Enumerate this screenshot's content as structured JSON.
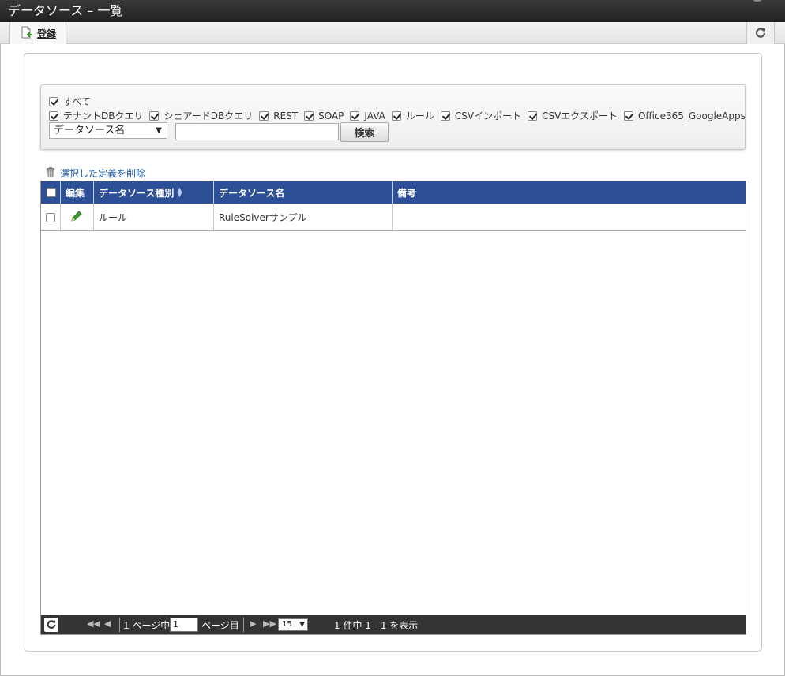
{
  "window": {
    "title": "データソース – 一覧"
  },
  "toolbar": {
    "register_label": "登録"
  },
  "filters": {
    "all_label": "すべて",
    "types": [
      {
        "label": "テナントDBクエリ",
        "checked": true
      },
      {
        "label": "シェアードDBクエリ",
        "checked": true
      },
      {
        "label": "REST",
        "checked": true
      },
      {
        "label": "SOAP",
        "checked": true
      },
      {
        "label": "JAVA",
        "checked": true
      },
      {
        "label": "ルール",
        "checked": true
      },
      {
        "label": "CSVインポート",
        "checked": true
      },
      {
        "label": "CSVエクスポート",
        "checked": true
      },
      {
        "label": "Office365_GoogleApps",
        "checked": true
      }
    ],
    "field_select": "データソース名",
    "search_value": "",
    "search_button": "検索"
  },
  "actions": {
    "delete_selected": "選択した定義を削除"
  },
  "table": {
    "columns": {
      "edit": "編集",
      "type": "データソース種別",
      "name": "データソース名",
      "note": "備考"
    },
    "rows": [
      {
        "type": "ルール",
        "name": "RuleSolverサンプル",
        "note": ""
      }
    ]
  },
  "pager": {
    "page_prefix": "1 ページ中",
    "current_page": "1",
    "page_suffix": "ページ目",
    "page_size": "15",
    "summary": "1 件中 1 - 1 を表示"
  },
  "colors": {
    "header_bg": "#2d4f96",
    "pager_bg": "#333333",
    "link": "#1e5aa8",
    "edit_icon": "#3a9a2a"
  }
}
